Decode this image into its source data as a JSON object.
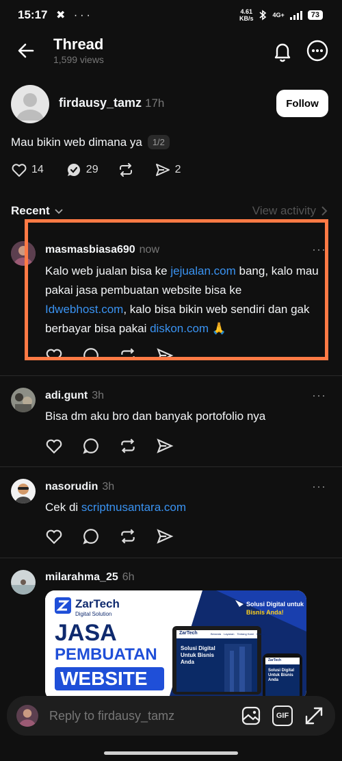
{
  "status_bar": {
    "time": "15:17",
    "left_icons": "✖ ···",
    "net_speed_value": "4.61",
    "net_speed_unit": "KB/s",
    "network": "4G+",
    "battery": "73"
  },
  "header": {
    "title": "Thread",
    "views": "1,599 views"
  },
  "post": {
    "username": "firdausy_tamz",
    "time": "17h",
    "follow_label": "Follow",
    "text": "Mau bikin web dimana ya",
    "pager": "1/2",
    "likes": "14",
    "comments": "29",
    "shares": "2"
  },
  "section": {
    "recent_label": "Recent",
    "view_activity_label": "View activity"
  },
  "comments": [
    {
      "username": "masmasbiasa690",
      "time": "now",
      "parts": {
        "t1": "Kalo web jualan bisa ke ",
        "l1": "jejualan.com",
        "t2": " bang, kalo mau pakai jasa pembuatan website bisa ke ",
        "l2": "Idwebhost.com",
        "t3": ", kalo bisa bikin web sendiri dan gak berbayar bisa pakai ",
        "l3": "diskon.com",
        "t4": " 🙏"
      }
    },
    {
      "username": "adi.gunt",
      "time": "3h",
      "text": "Bisa dm aku bro dan banyak portofolio nya"
    },
    {
      "username": "nasorudin",
      "time": "3h",
      "prefix": "Cek di ",
      "link": "scriptnusantara.com"
    },
    {
      "username": "milarahma_25",
      "time": "6h"
    }
  ],
  "ad": {
    "brand": "ZarTech",
    "brand_sub": "Digital Solution",
    "tagline_line1": "Solusi Digital untuk",
    "tagline_line2": "Bisnis Anda!",
    "title_line1": "JASA",
    "title_line2": "PEMBUATAN",
    "title_line3": "WEBSITE",
    "mock_title": "Solusi Digital Untuk Bisnis Anda",
    "mock_nav": [
      "Beranda",
      "Layanan",
      "Tentang Kami",
      "Kontak"
    ]
  },
  "reply_bar": {
    "placeholder": "Reply to firdausy_tamz",
    "gif_label": "GIF"
  },
  "colors": {
    "background": "#101010",
    "link": "#3a93f2",
    "highlight": "#ff7a45",
    "ad_blue": "#1f4fd8"
  }
}
